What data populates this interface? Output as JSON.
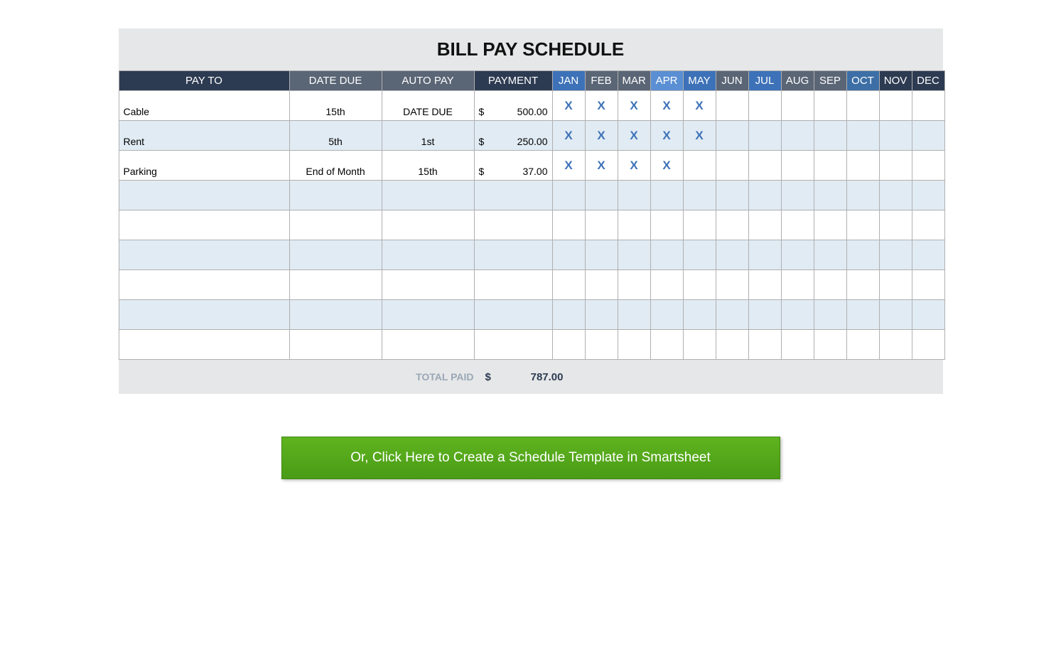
{
  "title": "BILL PAY SCHEDULE",
  "headers": {
    "pay_to": "PAY TO",
    "date_due": "DATE DUE",
    "auto_pay": "AUTO PAY",
    "payment": "PAYMENT",
    "months": [
      "JAN",
      "FEB",
      "MAR",
      "APR",
      "MAY",
      "JUN",
      "JUL",
      "AUG",
      "SEP",
      "OCT",
      "NOV",
      "DEC"
    ]
  },
  "currency_symbol": "$",
  "rows": [
    {
      "pay_to": "Cable",
      "date_due": "15th",
      "auto_pay": "DATE DUE",
      "payment": "500.00",
      "months": [
        "X",
        "X",
        "X",
        "X",
        "X",
        "",
        "",
        "",
        "",
        "",
        "",
        ""
      ]
    },
    {
      "pay_to": "Rent",
      "date_due": "5th",
      "auto_pay": "1st",
      "payment": "250.00",
      "months": [
        "X",
        "X",
        "X",
        "X",
        "X",
        "",
        "",
        "",
        "",
        "",
        "",
        ""
      ]
    },
    {
      "pay_to": "Parking",
      "date_due": "End of Month",
      "auto_pay": "15th",
      "payment": "37.00",
      "months": [
        "X",
        "X",
        "X",
        "X",
        "",
        "",
        "",
        "",
        "",
        "",
        "",
        ""
      ]
    },
    {
      "pay_to": "",
      "date_due": "",
      "auto_pay": "",
      "payment": "",
      "months": [
        "",
        "",
        "",
        "",
        "",
        "",
        "",
        "",
        "",
        "",
        "",
        ""
      ]
    },
    {
      "pay_to": "",
      "date_due": "",
      "auto_pay": "",
      "payment": "",
      "months": [
        "",
        "",
        "",
        "",
        "",
        "",
        "",
        "",
        "",
        "",
        "",
        ""
      ]
    },
    {
      "pay_to": "",
      "date_due": "",
      "auto_pay": "",
      "payment": "",
      "months": [
        "",
        "",
        "",
        "",
        "",
        "",
        "",
        "",
        "",
        "",
        "",
        ""
      ]
    },
    {
      "pay_to": "",
      "date_due": "",
      "auto_pay": "",
      "payment": "",
      "months": [
        "",
        "",
        "",
        "",
        "",
        "",
        "",
        "",
        "",
        "",
        "",
        ""
      ]
    },
    {
      "pay_to": "",
      "date_due": "",
      "auto_pay": "",
      "payment": "",
      "months": [
        "",
        "",
        "",
        "",
        "",
        "",
        "",
        "",
        "",
        "",
        "",
        ""
      ]
    },
    {
      "pay_to": "",
      "date_due": "",
      "auto_pay": "",
      "payment": "",
      "months": [
        "",
        "",
        "",
        "",
        "",
        "",
        "",
        "",
        "",
        "",
        "",
        ""
      ]
    }
  ],
  "total_label": "TOTAL PAID",
  "total_value": "787.00",
  "cta_label": "Or, Click Here to Create a Schedule Template in Smartsheet",
  "month_header_colors": [
    "h-blue",
    "h-grey",
    "h-grey",
    "h-lblue",
    "h-blue",
    "h-grey",
    "h-blue",
    "h-grey",
    "h-grey",
    "h-mblue",
    "h-dark2",
    "h-dark2"
  ]
}
